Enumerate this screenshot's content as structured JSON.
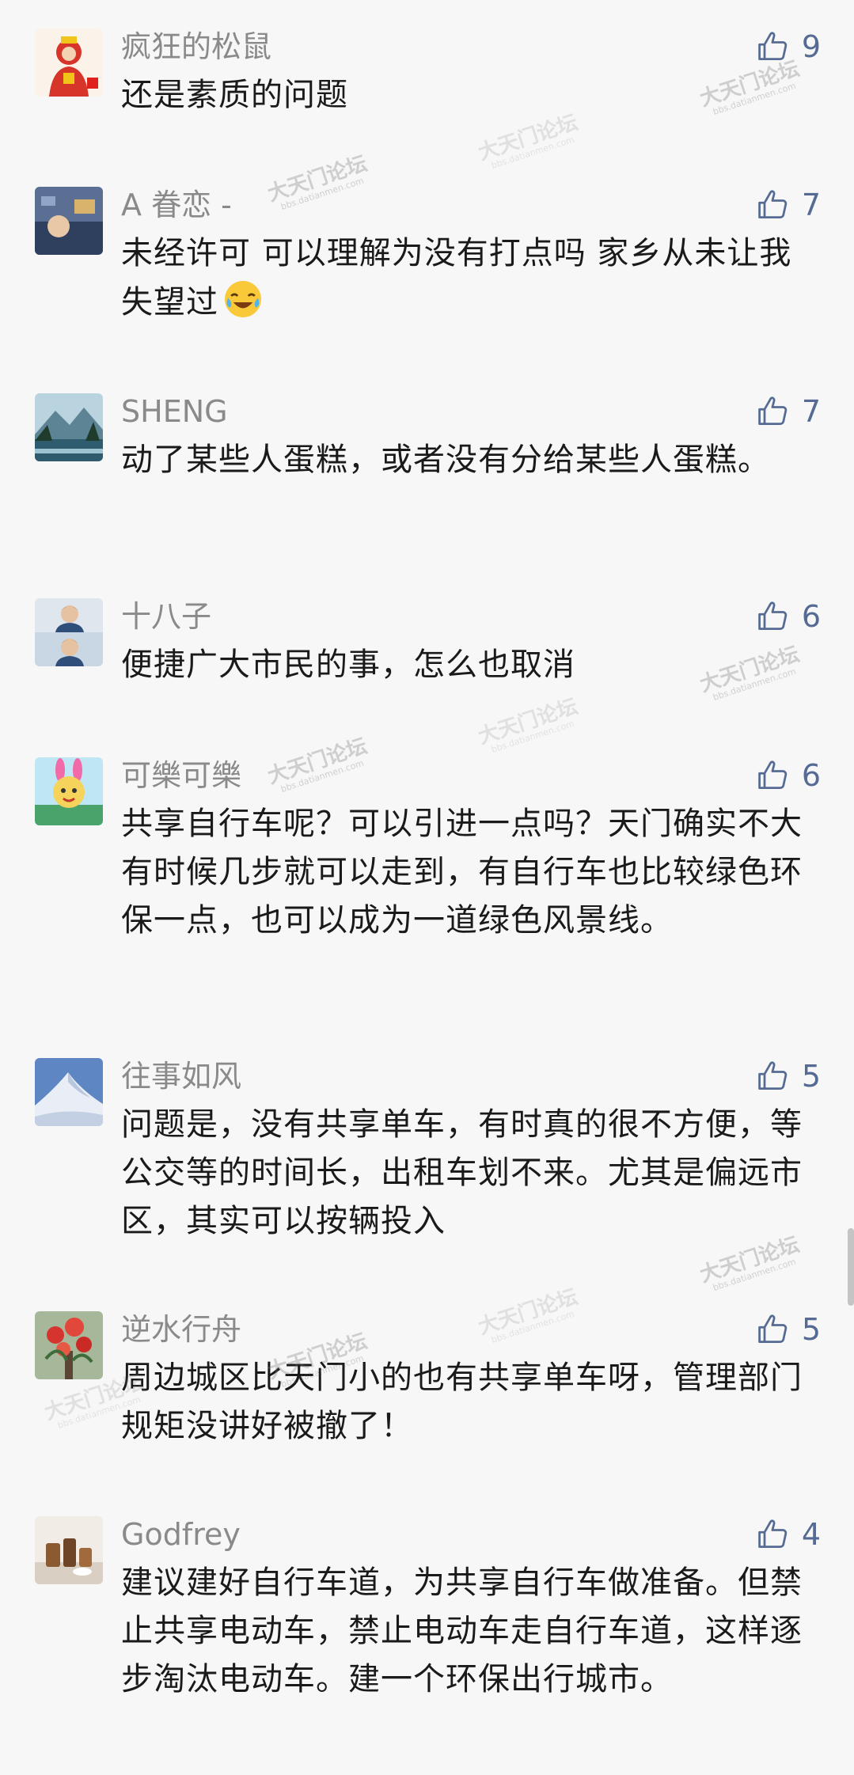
{
  "colors": {
    "background": "#f7f7f7",
    "username": "#8a8a8a",
    "like_accent": "#566b94",
    "text": "#1a1a1a"
  },
  "watermark": {
    "title": "大天门论坛",
    "sub": "bbs.datianmen.com"
  },
  "comments": [
    {
      "user": "疯狂的松鼠",
      "avatar_icon": "red-figure-avatar-icon",
      "likes": "9",
      "text": "还是素质的问题"
    },
    {
      "user": "A 眷恋 -",
      "avatar_icon": "photo-avatar-icon",
      "likes": "7",
      "text": "未经许可 可以理解为没有打点吗 家乡从未让我失望过",
      "emoji": "crying-laughing-emoji-icon"
    },
    {
      "user": "SHENG",
      "avatar_icon": "mountain-lake-avatar-icon",
      "likes": "7",
      "text": "动了某些人蛋糕，或者没有分给某些人蛋糕。"
    },
    {
      "user": "十八子",
      "avatar_icon": "portrait-avatar-icon",
      "likes": "6",
      "text": "便捷广大市民的事，怎么也取消"
    },
    {
      "user": "可樂可樂",
      "avatar_icon": "bunny-ears-avatar-icon",
      "likes": "6",
      "text": "共享自行车呢？可以引进一点吗？天门确实不大有时候几步就可以走到，有自行车也比较绿色环保一点，也可以成为一道绿色风景线。"
    },
    {
      "user": "往事如风",
      "avatar_icon": "snow-mountain-avatar-icon",
      "likes": "5",
      "text": "问题是，没有共享单车，有时真的很不方便，等公交等的时间长，出租车划不来。尤其是偏远市区，其实可以按辆投入"
    },
    {
      "user": "逆水行舟",
      "avatar_icon": "flowers-avatar-icon",
      "likes": "5",
      "text": "周边城区比天门小的也有共享单车呀，管理部门规矩没讲好被撤了！"
    },
    {
      "user": "Godfrey",
      "avatar_icon": "cups-avatar-icon",
      "likes": "4",
      "text": "建议建好自行车道，为共享自行车做准备。但禁止共享电动车，禁止电动车走自行车道，这样逐步淘汰电动车。建一个环保出行城市。"
    }
  ]
}
